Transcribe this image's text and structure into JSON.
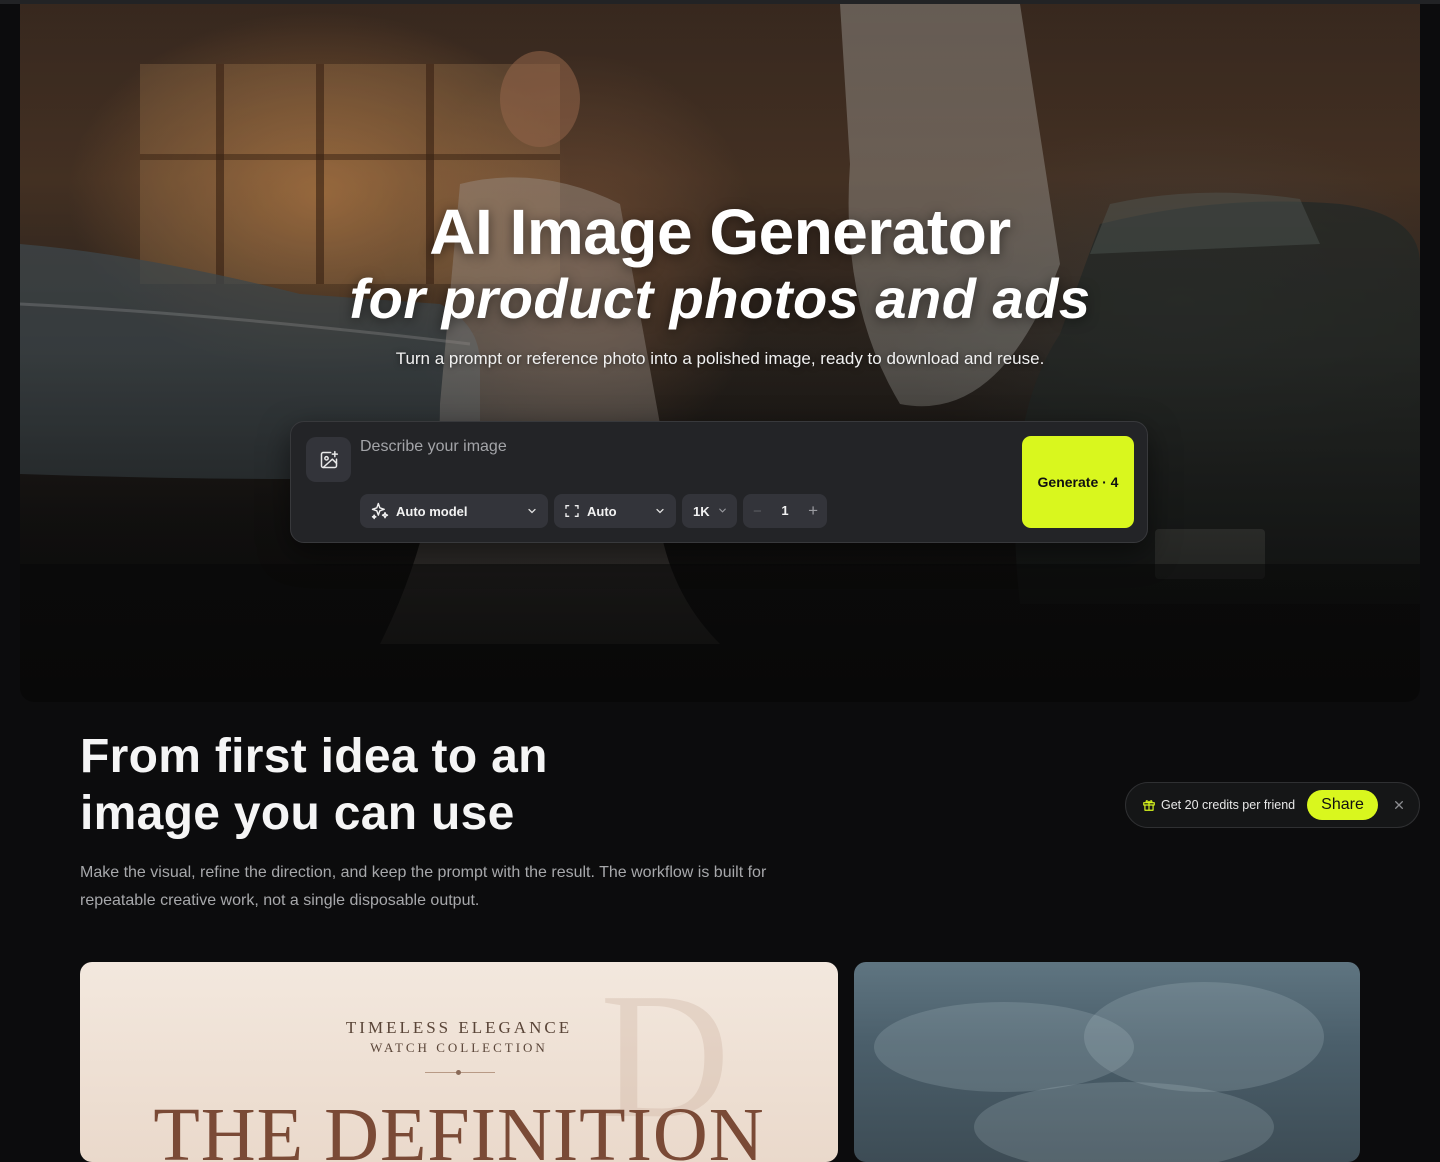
{
  "hero": {
    "title": "AI Image Generator",
    "subtitle": "for product photos and ads",
    "description": "Turn a prompt or reference photo into a polished image, ready to download and reuse."
  },
  "prompt": {
    "placeholder": "Describe your image",
    "model_label": "Auto model",
    "aspect_label": "Auto",
    "resolution_label": "1K",
    "count_value": "1",
    "decrement_label": "−",
    "increment_label": "+",
    "generate_label": "Generate · 4"
  },
  "section": {
    "title": "From first idea to an image you can use",
    "description": "Make the visual, refine the direction, and keep the prompt with the result. The workflow is built for repeatable creative work, not a single disposable output."
  },
  "referral": {
    "text": "Get 20 credits per friend",
    "share_label": "Share"
  },
  "cards": {
    "watch": {
      "kicker": "TIMELESS ELEGANCE",
      "subkicker": "WATCH COLLECTION",
      "headline": "THE DEFINITION"
    }
  },
  "colors": {
    "accent": "#d9f71e",
    "background": "#0c0c0d",
    "panel": "#232427",
    "control": "#33343a"
  },
  "icons": {
    "upload": "image-plus-icon",
    "model": "sparkles-icon",
    "aspect": "frame-corners-icon",
    "dropdown": "chevron-down-icon",
    "gift": "gift-icon",
    "close": "close-icon"
  }
}
